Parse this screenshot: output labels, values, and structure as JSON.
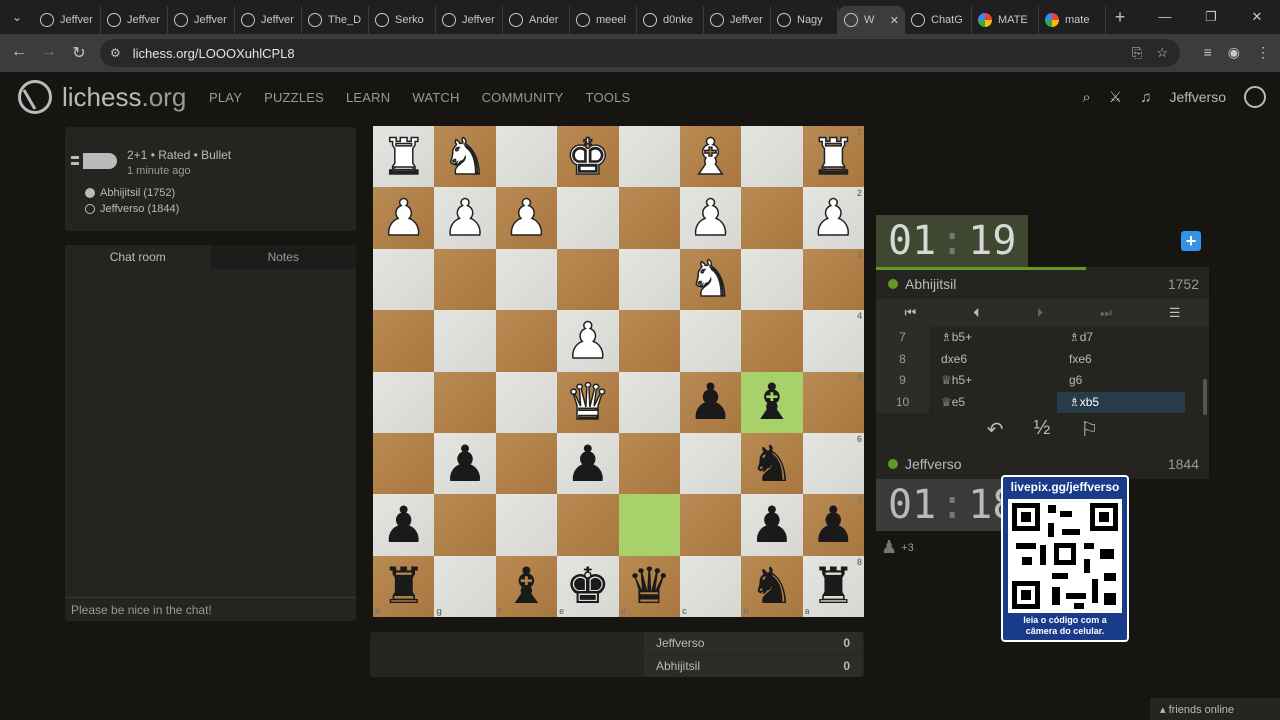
{
  "browser": {
    "tabs": [
      {
        "label": "Jeffver",
        "active": false
      },
      {
        "label": "Jeffver",
        "active": false
      },
      {
        "label": "Jeffver",
        "active": false
      },
      {
        "label": "Jeffver",
        "active": false
      },
      {
        "label": "The_D",
        "active": false
      },
      {
        "label": "Serko",
        "active": false
      },
      {
        "label": "Jeffver",
        "active": false
      },
      {
        "label": "Ander",
        "active": false
      },
      {
        "label": "meeel",
        "active": false
      },
      {
        "label": "d0nke",
        "active": false
      },
      {
        "label": "Jeffver",
        "active": false
      },
      {
        "label": "Nagy",
        "active": false
      },
      {
        "label": "W",
        "active": true
      },
      {
        "label": "ChatG",
        "active": false
      },
      {
        "label": "MATE",
        "active": false
      },
      {
        "label": "mate",
        "active": false
      }
    ],
    "url": "lichess.org/LOOOXuhlCPL8"
  },
  "site": {
    "logo": "lichess",
    "logo_tld": ".org",
    "nav": [
      "PLAY",
      "PUZZLES",
      "LEARN",
      "WATCH",
      "COMMUNITY",
      "TOOLS"
    ],
    "username": "Jeffverso"
  },
  "game_info": {
    "mode": "2+1 • Rated • Bullet",
    "time_ago": "1 minute ago",
    "white_player": "Abhijitsil (1752)",
    "black_player": "Jeffverso (1844)"
  },
  "chat": {
    "tabs": [
      "Chat room",
      "Notes"
    ],
    "input_placeholder": "Please be nice in the chat!"
  },
  "board": {
    "rank_labels": [
      "1",
      "2",
      "3",
      "4",
      "5",
      "6",
      "7",
      "8"
    ],
    "file_labels": [
      "h",
      "g",
      "f",
      "e",
      "d",
      "c",
      "b",
      "a"
    ]
  },
  "scores": [
    {
      "name": "Jeffverso",
      "score": "0"
    },
    {
      "name": "Abhijitsil",
      "score": "0"
    }
  ],
  "panel": {
    "top_clock": {
      "min": "01",
      "sec": "19"
    },
    "bottom_clock": {
      "min": "01",
      "sec": "18"
    },
    "top_player": {
      "name": "Abhijitsil",
      "rating": "1752"
    },
    "bottom_player": {
      "name": "Jeffverso",
      "rating": "1844"
    },
    "moves": [
      {
        "n": "7",
        "w": "♗b5+",
        "b": "♗d7"
      },
      {
        "n": "8",
        "w": "dxe6",
        "b": "fxe6"
      },
      {
        "n": "9",
        "w": "♕h5+",
        "b": "g6"
      },
      {
        "n": "10",
        "w": "♕e5",
        "b": "♗xb5"
      }
    ],
    "draw_symbol": "½",
    "material_diff": "+3"
  },
  "overlay": {
    "header": "livepix.gg/jeffverso",
    "footer_line1": "leia o código com a",
    "footer_line2": "câmera do celular."
  },
  "footer": {
    "friends": "friends online"
  }
}
